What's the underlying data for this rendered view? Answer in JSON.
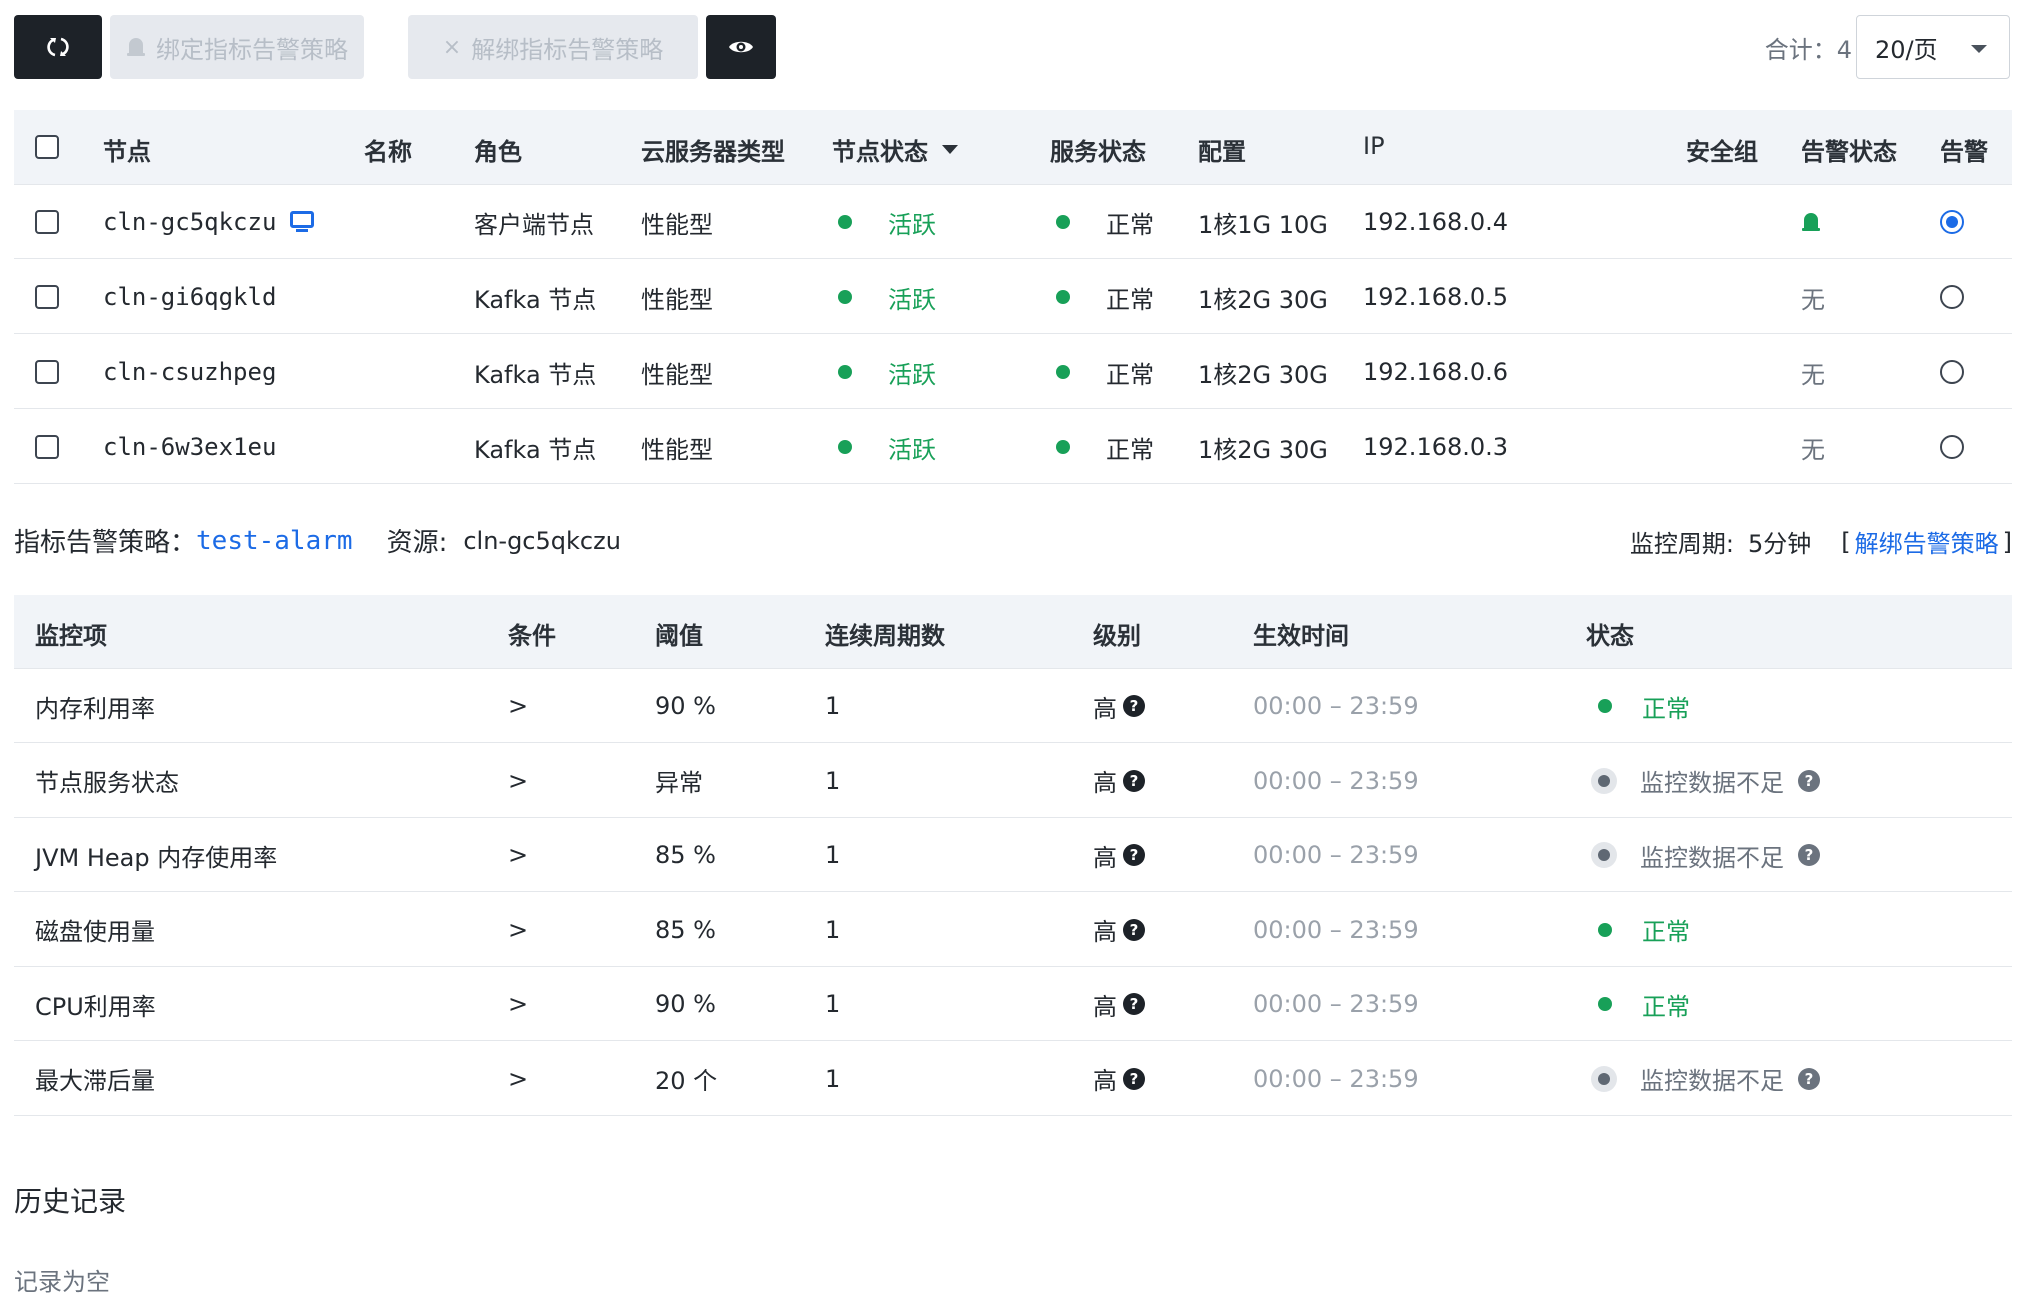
{
  "toolbar": {
    "bind_label": "绑定指标告警策略",
    "unbind_label": "解绑指标告警策略",
    "total_label": "合计：4",
    "page_size": "20/页"
  },
  "nodes_table": {
    "headers": {
      "node": "节点",
      "name": "名称",
      "role": "角色",
      "server_type": "云服务器类型",
      "node_status": "节点状态",
      "service_status": "服务状态",
      "config": "配置",
      "ip": "IP",
      "security_group": "安全组",
      "alarm_status": "告警状态",
      "alarm": "告警"
    },
    "rows": [
      {
        "node": "cln-gc5qkczu",
        "role": "客户端节点",
        "server_type": "性能型",
        "node_status": "活跃",
        "service_status": "正常",
        "config": "1核1G 10G",
        "ip": "192.168.0.4",
        "alarm_status": "",
        "selected": true
      },
      {
        "node": "cln-gi6qgkld",
        "role": "Kafka 节点",
        "server_type": "性能型",
        "node_status": "活跃",
        "service_status": "正常",
        "config": "1核2G 30G",
        "ip": "192.168.0.5",
        "alarm_status": "无",
        "selected": false
      },
      {
        "node": "cln-csuzhpeg",
        "role": "Kafka 节点",
        "server_type": "性能型",
        "node_status": "活跃",
        "service_status": "正常",
        "config": "1核2G 30G",
        "ip": "192.168.0.6",
        "alarm_status": "无",
        "selected": false
      },
      {
        "node": "cln-6w3ex1eu",
        "role": "Kafka 节点",
        "server_type": "性能型",
        "node_status": "活跃",
        "service_status": "正常",
        "config": "1核2G 30G",
        "ip": "192.168.0.3",
        "alarm_status": "无",
        "selected": false
      }
    ]
  },
  "policy": {
    "label": "指标告警策略：",
    "name": "test-alarm",
    "resource_label": "资源:",
    "resource": "cln-gc5qkczu",
    "period_label": "监控周期:",
    "period": "5分钟",
    "bracket_open": "[",
    "unbind_link": "解绑告警策略",
    "bracket_close": "]"
  },
  "metrics_table": {
    "headers": {
      "item": "监控项",
      "condition": "条件",
      "threshold": "阈值",
      "periods": "连续周期数",
      "level": "级别",
      "time": "生效时间",
      "status": "状态"
    },
    "rows": [
      {
        "item": "内存利用率",
        "condition": ">",
        "threshold": "90 %",
        "periods": "1",
        "level": "高",
        "time": "00:00 – 23:59",
        "status": "正常",
        "ok": true
      },
      {
        "item": "节点服务状态",
        "condition": ">",
        "threshold": "异常",
        "periods": "1",
        "level": "高",
        "time": "00:00 – 23:59",
        "status": "监控数据不足",
        "ok": false
      },
      {
        "item": "JVM Heap 内存使用率",
        "condition": ">",
        "threshold": "85 %",
        "periods": "1",
        "level": "高",
        "time": "00:00 – 23:59",
        "status": "监控数据不足",
        "ok": false
      },
      {
        "item": "磁盘使用量",
        "condition": ">",
        "threshold": "85 %",
        "periods": "1",
        "level": "高",
        "time": "00:00 – 23:59",
        "status": "正常",
        "ok": true
      },
      {
        "item": "CPU利用率",
        "condition": ">",
        "threshold": "90 %",
        "periods": "1",
        "level": "高",
        "time": "00:00 – 23:59",
        "status": "正常",
        "ok": true
      },
      {
        "item": "最大滞后量",
        "condition": ">",
        "threshold": "20 个",
        "periods": "1",
        "level": "高",
        "time": "00:00 – 23:59",
        "status": "监控数据不足",
        "ok": false
      }
    ]
  },
  "history": {
    "title": "历史记录",
    "empty": "记录为空"
  },
  "colors": {
    "accent": "#1c6be6",
    "success": "#18a058",
    "dark_button": "#1d2228",
    "header_bg": "#f1f4f8"
  }
}
